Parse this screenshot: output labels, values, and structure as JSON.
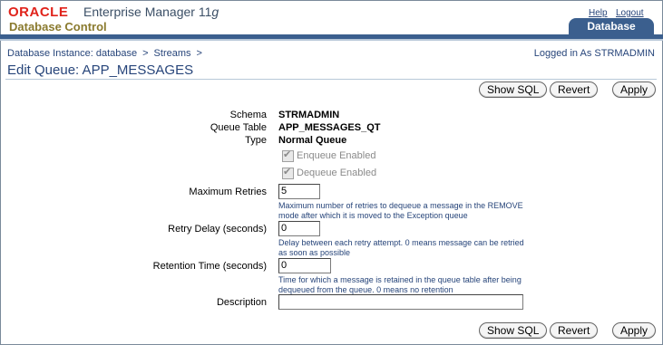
{
  "header": {
    "brand": "ORACLE",
    "product": "Enterprise Manager 11",
    "product_suffix": "g",
    "subtitle": "Database Control",
    "links": {
      "help": "Help",
      "logout": "Logout"
    },
    "tab": "Database"
  },
  "breadcrumb": {
    "items": [
      "Database Instance: database",
      "Streams"
    ],
    "separator": ">"
  },
  "logged_in": "Logged in As STRMADMIN",
  "page_title": "Edit Queue: APP_MESSAGES",
  "buttons": {
    "show_sql": "Show SQL",
    "revert": "Revert",
    "apply": "Apply"
  },
  "form": {
    "schema": {
      "label": "Schema",
      "value": "STRMADMIN"
    },
    "queue_table": {
      "label": "Queue Table",
      "value": "APP_MESSAGES_QT"
    },
    "type": {
      "label": "Type",
      "value": "Normal Queue"
    },
    "enqueue": {
      "label": "Enqueue Enabled",
      "checked": true,
      "disabled": true
    },
    "dequeue": {
      "label": "Dequeue Enabled",
      "checked": true,
      "disabled": true
    },
    "max_retries": {
      "label": "Maximum Retries",
      "value": "5",
      "hint": "Maximum number of retries to dequeue a message in the REMOVE mode after which it is moved to the Exception queue"
    },
    "retry_delay": {
      "label": "Retry Delay (seconds)",
      "value": "0",
      "hint": "Delay between each retry attempt. 0 means message can be retried as soon as possible"
    },
    "retention_time": {
      "label": "Retention Time (seconds)",
      "value": "0",
      "hint": "Time for which a message is retained in the queue table after being dequeued from the queue. 0 means no retention"
    },
    "description": {
      "label": "Description",
      "value": ""
    }
  },
  "colors": {
    "brand_red": "#e0231b",
    "link_blue": "#27457a",
    "tab_blue": "#3b5f8e",
    "gold": "#8a7a2e"
  }
}
